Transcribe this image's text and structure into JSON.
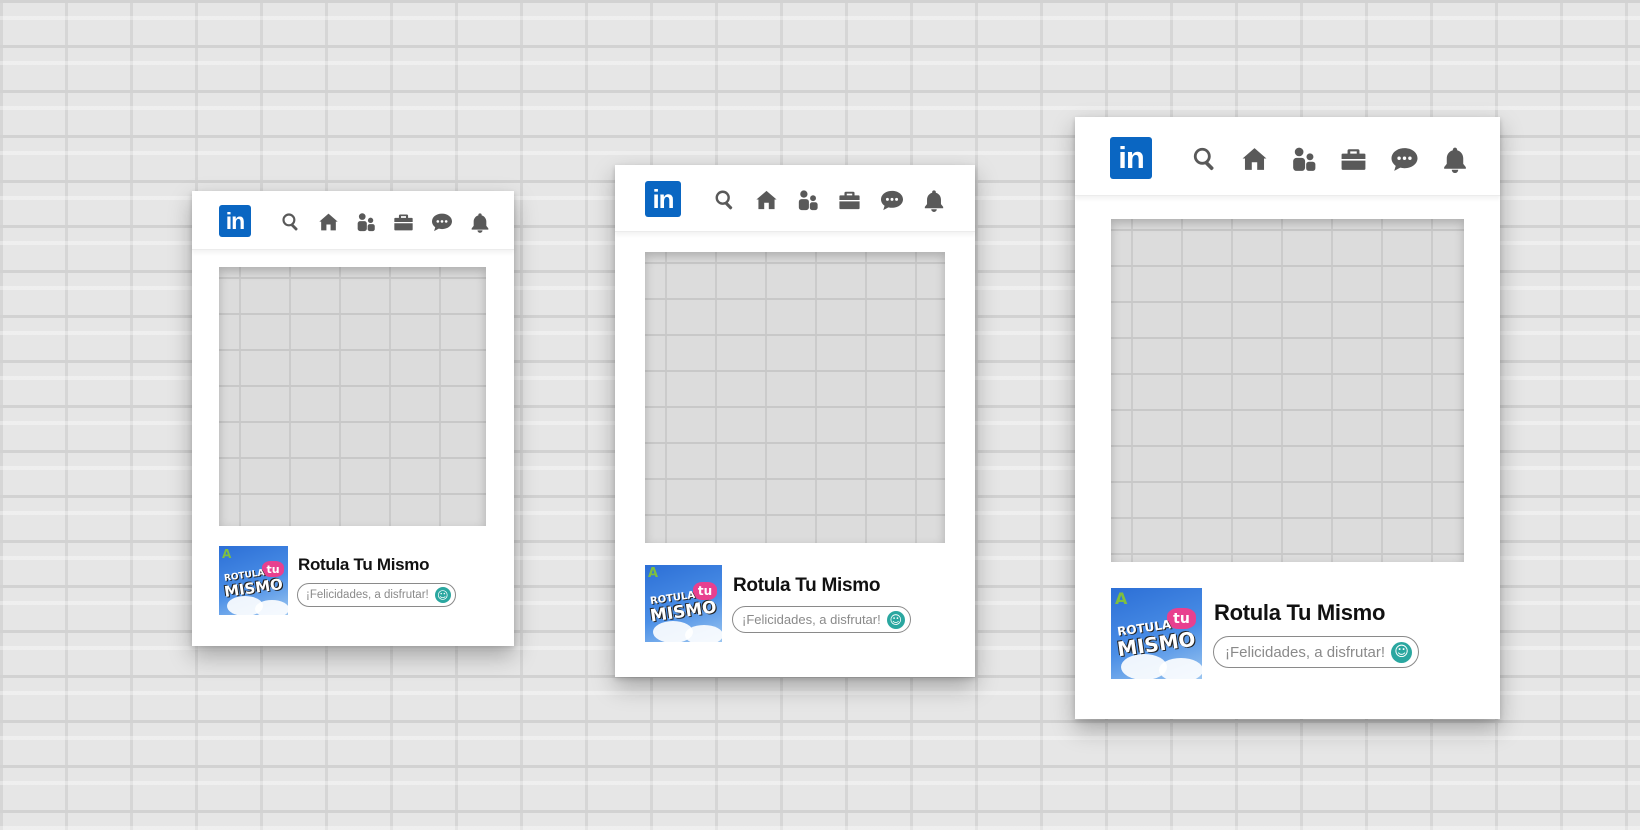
{
  "brand": {
    "logo_text": "in",
    "color": "#0a66c2"
  },
  "icons": [
    "search-icon",
    "home-icon",
    "network-icon",
    "jobs-icon",
    "messaging-icon",
    "notifications-icon"
  ],
  "frames": [
    {
      "profile_name": "Rotula Tu Mismo",
      "comment": "¡Felicidades, a disfrutar!",
      "avatar": {
        "word1": "ROTULA",
        "word2": "MISMO",
        "badge": "tu",
        "letter": "A"
      }
    },
    {
      "profile_name": "Rotula Tu Mismo",
      "comment": "¡Felicidades, a disfrutar!",
      "avatar": {
        "word1": "ROTULA",
        "word2": "MISMO",
        "badge": "tu",
        "letter": "A"
      }
    },
    {
      "profile_name": "Rotula Tu Mismo",
      "comment": "¡Felicidades, a disfrutar!",
      "avatar": {
        "word1": "ROTULA",
        "word2": "MISMO",
        "badge": "tu",
        "letter": "A"
      }
    }
  ]
}
